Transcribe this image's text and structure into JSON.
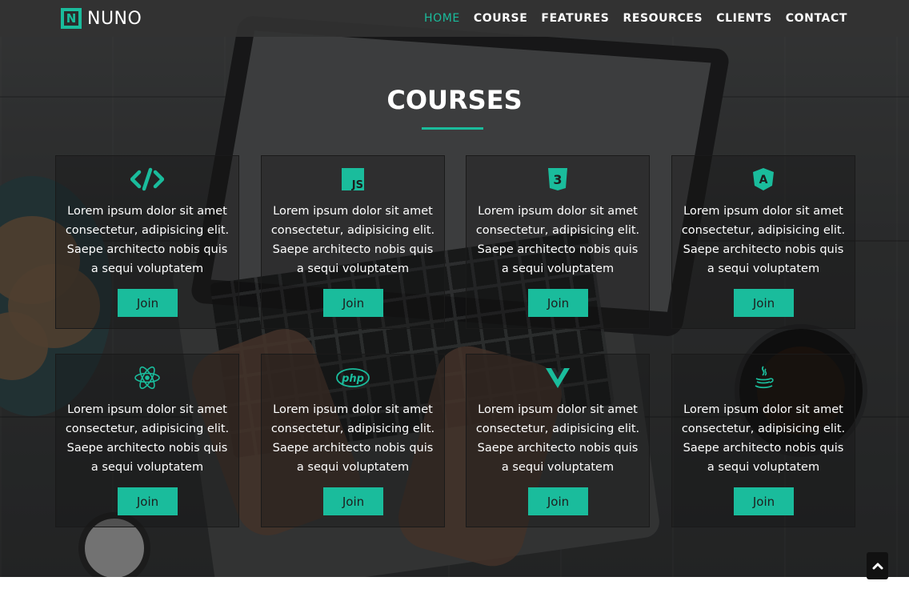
{
  "brand": {
    "logo_letter": "N",
    "name": "NUNO"
  },
  "nav": {
    "items": [
      {
        "label": "HOME",
        "active": true
      },
      {
        "label": "COURSE",
        "active": false
      },
      {
        "label": "FEATURES",
        "active": false
      },
      {
        "label": "RESOURCES",
        "active": false
      },
      {
        "label": "CLIENTS",
        "active": false
      },
      {
        "label": "CONTACT",
        "active": false
      }
    ]
  },
  "section": {
    "title": "COURSES"
  },
  "courses": [
    {
      "icon": "code-icon",
      "description": "Lorem ipsum dolor sit amet consectetur, adipisicing elit. Saepe architecto nobis quis a sequi voluptatem",
      "button": "Join"
    },
    {
      "icon": "javascript-icon",
      "icon_text": "JS",
      "description": "Lorem ipsum dolor sit amet consectetur, adipisicing elit. Saepe architecto nobis quis a sequi voluptatem",
      "button": "Join"
    },
    {
      "icon": "css3-icon",
      "icon_text": "3",
      "description": "Lorem ipsum dolor sit amet consectetur, adipisicing elit. Saepe architecto nobis quis a sequi voluptatem",
      "button": "Join"
    },
    {
      "icon": "angular-icon",
      "icon_text": "A",
      "description": "Lorem ipsum dolor sit amet consectetur, adipisicing elit. Saepe architecto nobis quis a sequi voluptatem",
      "button": "Join"
    },
    {
      "icon": "react-icon",
      "description": "Lorem ipsum dolor sit amet consectetur, adipisicing elit. Saepe architecto nobis quis a sequi voluptatem",
      "button": "Join"
    },
    {
      "icon": "php-icon",
      "icon_text": "php",
      "description": "Lorem ipsum dolor sit amet consectetur, adipisicing elit. Saepe architecto nobis quis a sequi voluptatem",
      "button": "Join"
    },
    {
      "icon": "vue-icon",
      "description": "Lorem ipsum dolor sit amet consectetur, adipisicing elit. Saepe architecto nobis quis a sequi voluptatem",
      "button": "Join"
    },
    {
      "icon": "java-icon",
      "description": "Lorem ipsum dolor sit amet consectetur, adipisicing elit. Saepe architecto nobis quis a sequi voluptatem",
      "button": "Join"
    }
  ],
  "colors": {
    "accent": "#1abc9c",
    "navbar": "#323232",
    "text": "#ffffff"
  },
  "scroll_top": {
    "icon": "chevron-up-icon"
  }
}
